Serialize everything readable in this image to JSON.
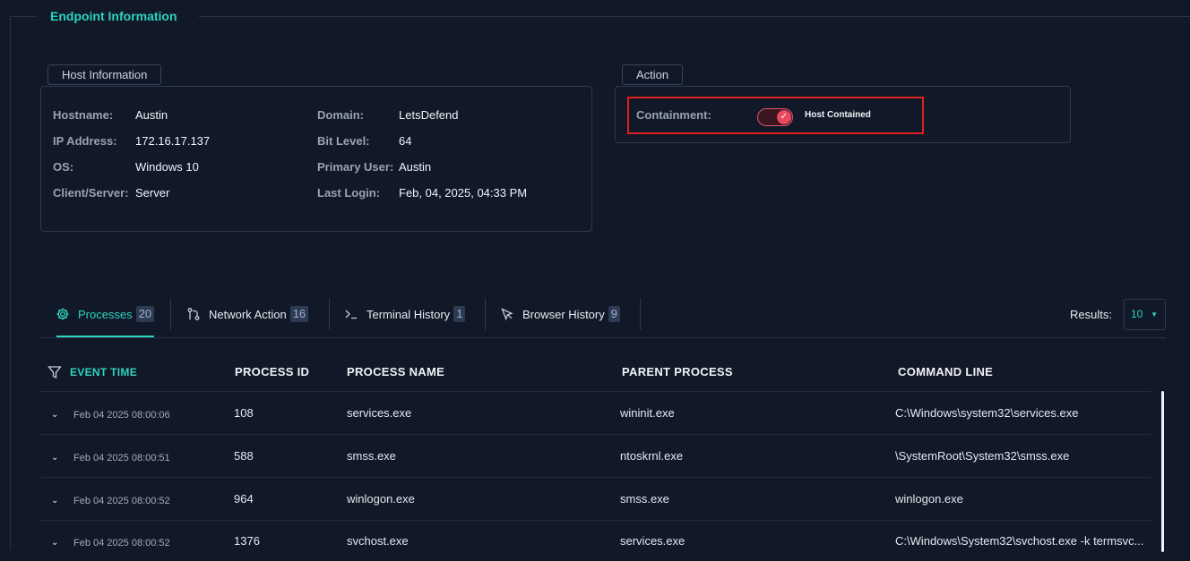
{
  "section": {
    "title": "Endpoint Information"
  },
  "host_info": {
    "legend": "Host Information",
    "left": [
      {
        "key": "Hostname:",
        "value": "Austin"
      },
      {
        "key": "IP Address:",
        "value": "172.16.17.137"
      },
      {
        "key": "OS:",
        "value": "Windows 10"
      },
      {
        "key": "Client/Server:",
        "value": "Server"
      }
    ],
    "right": [
      {
        "key": "Domain:",
        "value": "LetsDefend"
      },
      {
        "key": "Bit Level:",
        "value": "64"
      },
      {
        "key": "Primary User:",
        "value": "Austin"
      },
      {
        "key": "Last Login:",
        "value": "Feb, 04, 2025, 04:33 PM"
      }
    ]
  },
  "action": {
    "legend": "Action",
    "containment_label": "Containment:",
    "toggle_on": true,
    "status_text": "Host Contained",
    "highlight_color": "#e01e1e"
  },
  "tabs": [
    {
      "label": "Processes",
      "count": "20",
      "icon": "gear-icon",
      "active": true
    },
    {
      "label": "Network Action",
      "count": "16",
      "icon": "git-branch-icon",
      "active": false
    },
    {
      "label": "Terminal History",
      "count": "1",
      "icon": "terminal-icon",
      "active": false
    },
    {
      "label": "Browser History",
      "count": "9",
      "icon": "cursor-icon",
      "active": false
    }
  ],
  "results": {
    "label": "Results:",
    "value": "10"
  },
  "table": {
    "columns": [
      "EVENT TIME",
      "PROCESS ID",
      "PROCESS NAME",
      "PARENT PROCESS",
      "COMMAND LINE"
    ],
    "rows": [
      {
        "time": "Feb 04 2025 08:00:06",
        "pid": "108",
        "name": "services.exe",
        "parent": "wininit.exe",
        "cmd": "C:\\Windows\\system32\\services.exe"
      },
      {
        "time": "Feb 04 2025 08:00:51",
        "pid": "588",
        "name": "smss.exe",
        "parent": "ntoskrnl.exe",
        "cmd": "\\SystemRoot\\System32\\smss.exe"
      },
      {
        "time": "Feb 04 2025 08:00:52",
        "pid": "964",
        "name": "winlogon.exe",
        "parent": "smss.exe",
        "cmd": "winlogon.exe"
      },
      {
        "time": "Feb 04 2025 08:00:52",
        "pid": "1376",
        "name": "svchost.exe",
        "parent": "services.exe",
        "cmd": "C:\\Windows\\System32\\svchost.exe -k termsvc..."
      }
    ]
  },
  "colors": {
    "accent": "#2dd4bf",
    "background": "#111828",
    "toggle_red": "#e84a5f"
  }
}
